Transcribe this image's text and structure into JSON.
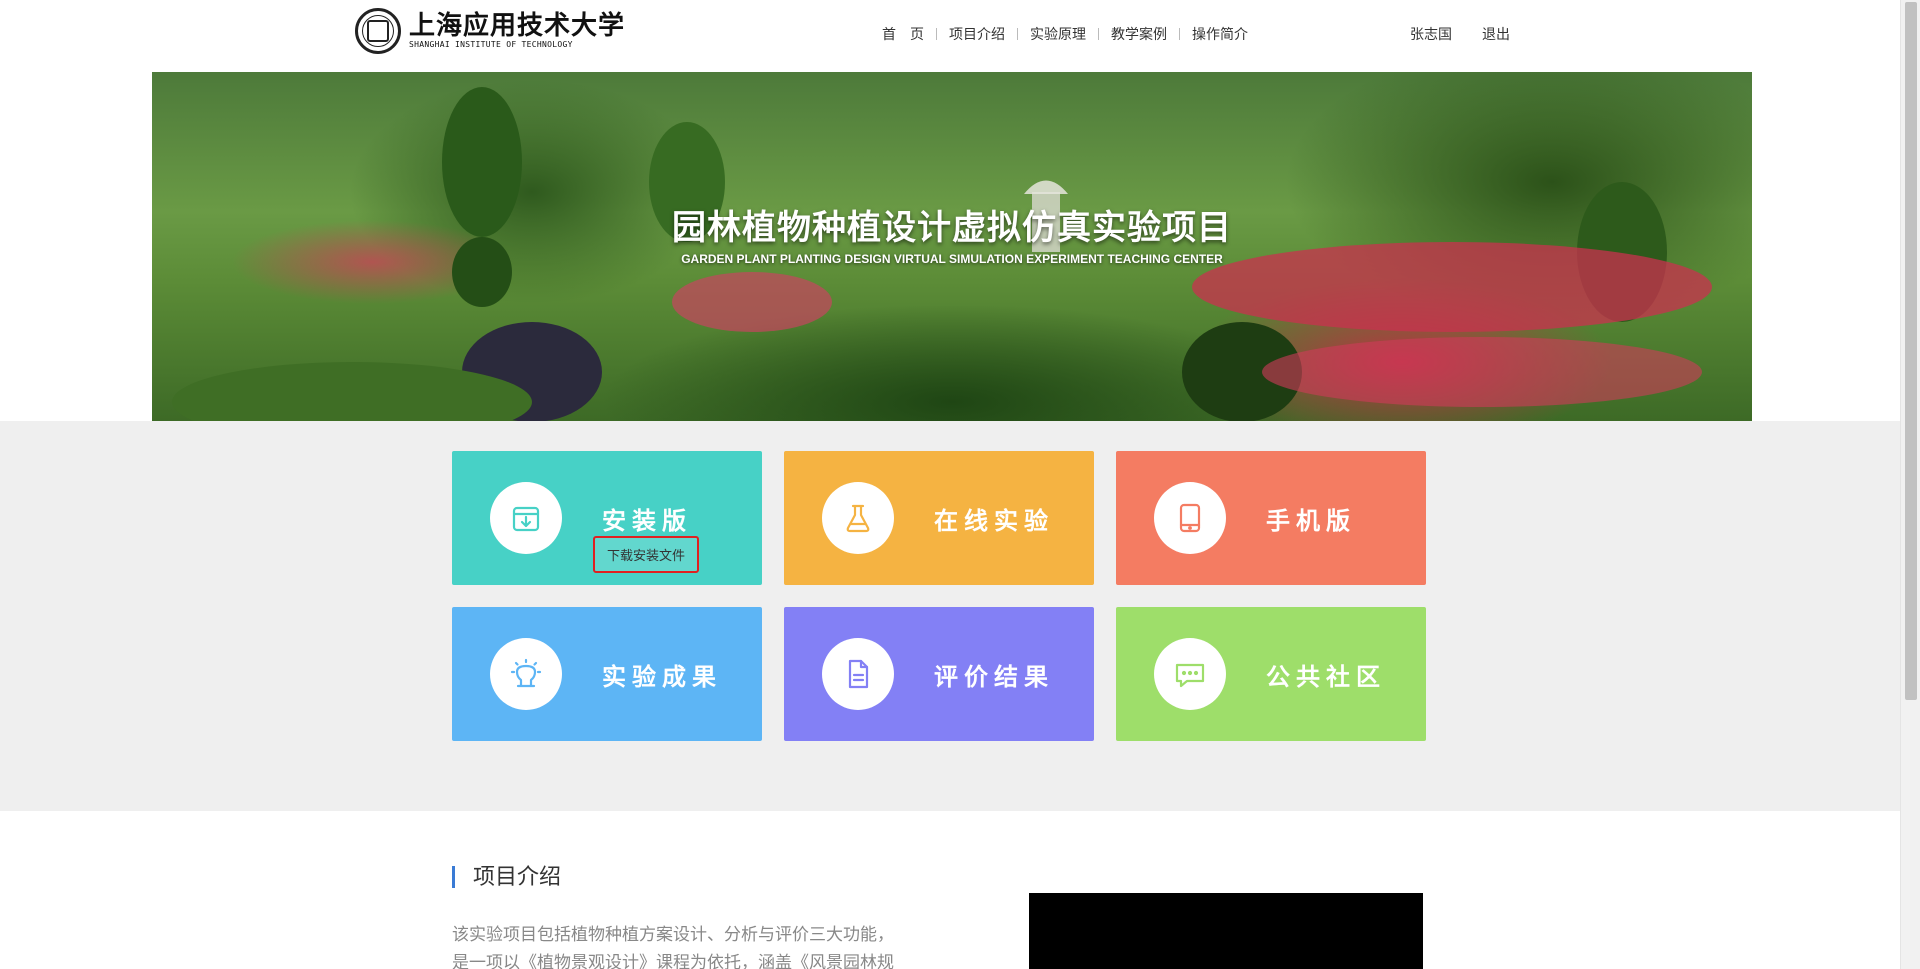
{
  "header": {
    "logo_cn": "上海应用技术大学",
    "logo_en": "SHANGHAI INSTITUTE OF TECHNOLOGY",
    "nav": [
      "首　页",
      "项目介绍",
      "实验原理",
      "教学案例",
      "操作简介"
    ],
    "user_name": "张志国",
    "logout": "退出"
  },
  "banner": {
    "title": "园林植物种植设计虚拟仿真实验项目",
    "subtitle": "GARDEN PLANT PLANTING DESIGN VIRTUAL SIMULATION EXPERIMENT TEACHING CENTER"
  },
  "tiles": [
    {
      "label": "安装版",
      "icon": "download-box-icon",
      "color": "#47d1c6"
    },
    {
      "label": "在线实验",
      "icon": "flask-icon",
      "color": "#f5b342"
    },
    {
      "label": "手机版",
      "icon": "tablet-icon",
      "color": "#f47c62"
    },
    {
      "label": "实验成果",
      "icon": "lightbulb-icon",
      "color": "#5db5f5"
    },
    {
      "label": "评价结果",
      "icon": "document-icon",
      "color": "#8380f5"
    },
    {
      "label": "公共社区",
      "icon": "chat-icon",
      "color": "#9ede6a"
    }
  ],
  "tooltip": "下载安装文件",
  "intro": {
    "title": "项目介绍",
    "text_lines": [
      "该实验项目包括植物种植方案设计、分析与评价三大功能，",
      "是一项以《植物景观设计》课程为依托，涵盖《风景园林规"
    ]
  },
  "accent_color": "#3a7bd5"
}
